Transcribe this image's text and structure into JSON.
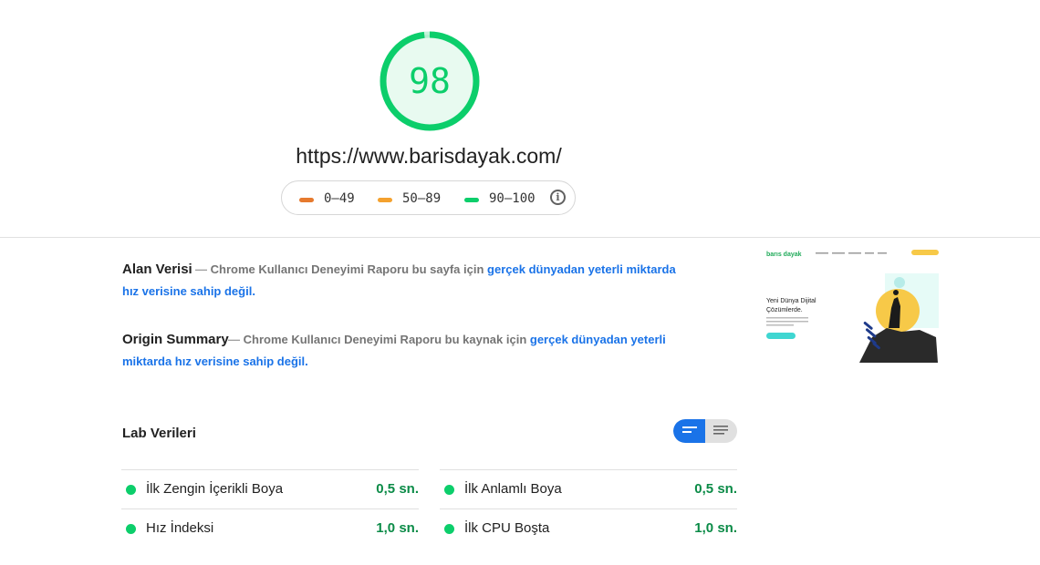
{
  "score": {
    "value": "98",
    "fraction": 0.98,
    "color": "#0cce6b"
  },
  "url": "https://www.barisdayak.com/",
  "legend": [
    {
      "range": "0–49",
      "color": "#e67a2e"
    },
    {
      "range": "50–89",
      "color": "#f4a12e"
    },
    {
      "range": "90–100",
      "color": "#0cce6b"
    }
  ],
  "legend_info_icon": "info-icon",
  "field_data": {
    "title": "Alan Verisi",
    "sep": "—",
    "text": "Chrome Kullanıcı Deneyimi Raporu bu sayfa için",
    "link": "gerçek dünyadan yeterli miktarda hız verisine sahip değil."
  },
  "origin_summary": {
    "title": "Origin Summary",
    "sep": "—",
    "text": "Chrome Kullanıcı Deneyimi Raporu bu kaynak için",
    "link": "gerçek dünyadan yeterli miktarda hız verisine sahip değil."
  },
  "thumbnail": {
    "logo": "barıs dayak",
    "headline_1": "Yeni Dünya Dijital",
    "headline_2": "Çözümlerde."
  },
  "lab": {
    "title": "Lab Verileri",
    "metrics": [
      {
        "label": "İlk Zengin İçerikli Boya",
        "value": "0,5 sn."
      },
      {
        "label": "İlk Anlamlı Boya",
        "value": "0,5 sn."
      },
      {
        "label": "Hız İndeksi",
        "value": "1,0 sn."
      },
      {
        "label": "İlk CPU Boşta",
        "value": "1,0 sn."
      }
    ]
  }
}
